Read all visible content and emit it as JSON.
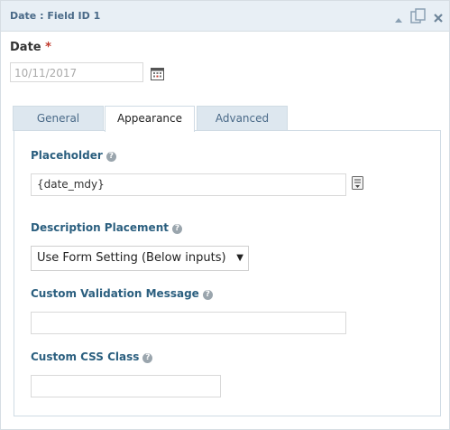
{
  "window": {
    "title": "Date : Field ID 1"
  },
  "titlebar_icons": [
    "collapse-arrow-icon",
    "duplicate-icon",
    "close-icon"
  ],
  "field": {
    "label": "Date",
    "required_marker": "*",
    "placeholder_value": "10/11/2017"
  },
  "tabs": [
    {
      "label": "General",
      "active": false
    },
    {
      "label": "Appearance",
      "active": true
    },
    {
      "label": "Advanced",
      "active": false
    }
  ],
  "settings": {
    "placeholder": {
      "label": "Placeholder",
      "value": "{date_mdy}"
    },
    "description_placement": {
      "label": "Description Placement",
      "selected": "Use Form Setting (Below inputs)"
    },
    "custom_validation": {
      "label": "Custom Validation Message",
      "value": ""
    },
    "custom_css": {
      "label": "Custom CSS Class",
      "value": ""
    },
    "help_glyph": "?"
  },
  "colors": {
    "titlebar_bg": "#e8eff5",
    "label_blue": "#2b5f7f",
    "required_red": "#c0392b"
  }
}
